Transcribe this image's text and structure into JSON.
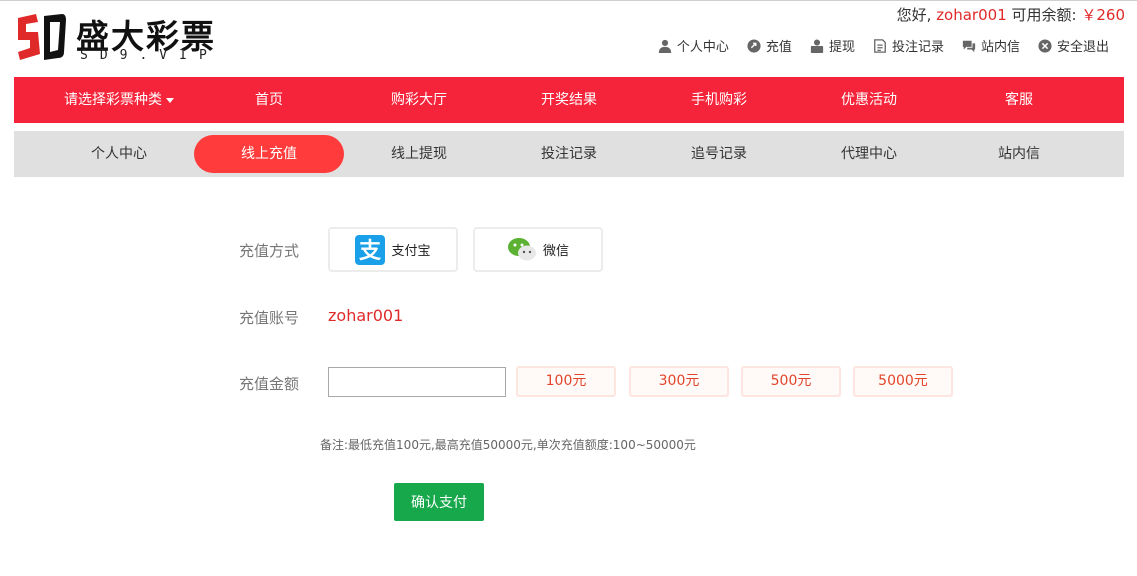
{
  "header": {
    "logo_title": "盛大彩票",
    "logo_sub": "SD9.VIP",
    "greeting_prefix": "您好,",
    "username": "zohar001",
    "balance_label": "可用余额:",
    "balance_value": "￥260",
    "user_links": [
      {
        "label": "个人中心",
        "icon": "user-icon"
      },
      {
        "label": "充值",
        "icon": "recharge-icon"
      },
      {
        "label": "提现",
        "icon": "withdraw-icon"
      },
      {
        "label": "投注记录",
        "icon": "record-icon"
      },
      {
        "label": "站内信",
        "icon": "message-icon"
      },
      {
        "label": "安全退出",
        "icon": "logout-icon"
      }
    ]
  },
  "main_nav": [
    {
      "label": "请选择彩票种类"
    },
    {
      "label": "首页"
    },
    {
      "label": "购彩大厅"
    },
    {
      "label": "开奖结果"
    },
    {
      "label": "手机购彩"
    },
    {
      "label": "优惠活动"
    },
    {
      "label": "客服"
    }
  ],
  "sub_nav": [
    {
      "label": "个人中心"
    },
    {
      "label": "线上充值"
    },
    {
      "label": "线上提现"
    },
    {
      "label": "投注记录"
    },
    {
      "label": "追号记录"
    },
    {
      "label": "代理中心"
    },
    {
      "label": "站内信"
    }
  ],
  "form": {
    "method_label": "充值方式",
    "methods": [
      {
        "label": "支付宝",
        "icon": "alipay-icon",
        "color": "#1aa0e8"
      },
      {
        "label": "微信",
        "icon": "wechat-icon",
        "color": "#5bb131"
      }
    ],
    "account_label": "充值账号",
    "account_value": "zohar001",
    "amount_label": "充值金额",
    "amount_value": "",
    "amount_options": [
      "100元",
      "300元",
      "500元",
      "5000元"
    ],
    "note": "备注:最低充值100元,最高充值50000元,单次充值额度:100~50000元",
    "confirm_label": "确认支付"
  },
  "colors": {
    "brand_red": "#f5243a",
    "active_tab": "#ff3b3b",
    "confirm_green": "#16a84b",
    "subnav_grey": "#e0e0e0"
  }
}
